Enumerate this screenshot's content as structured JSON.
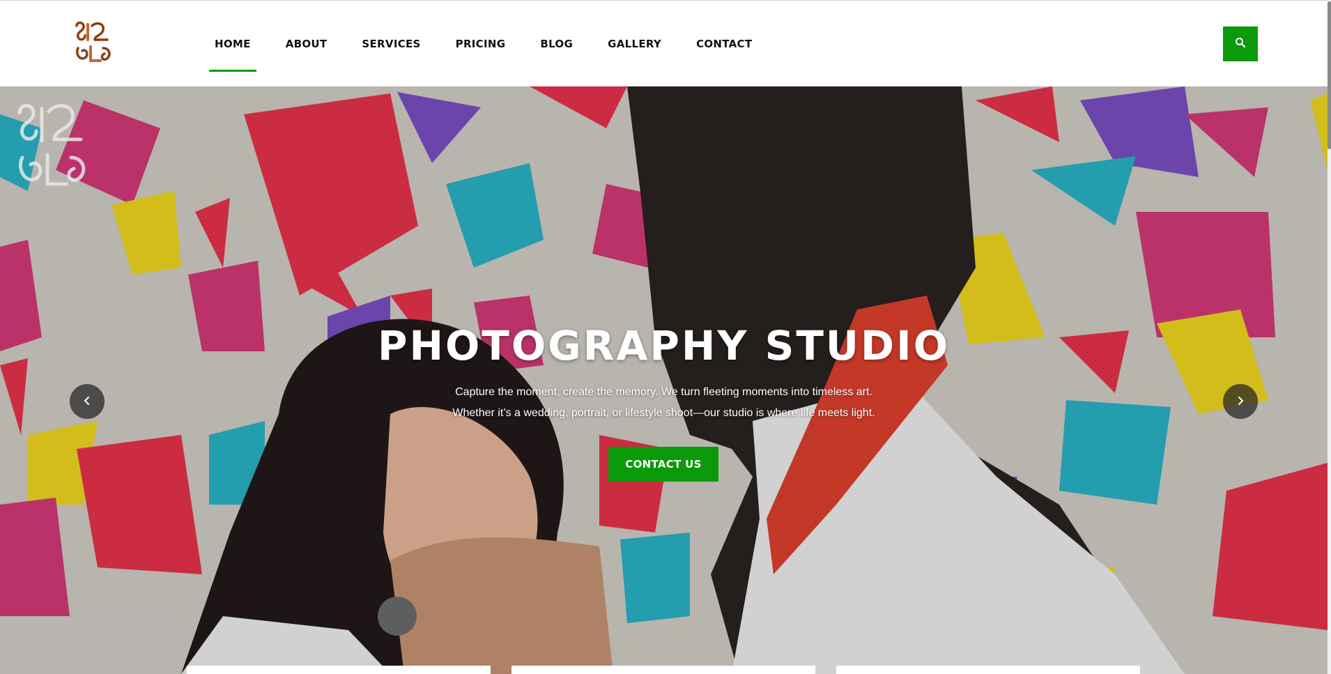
{
  "header": {
    "logo_icon": "brand-logo-icon",
    "nav": [
      {
        "label": "HOME",
        "active": true
      },
      {
        "label": "ABOUT",
        "active": false
      },
      {
        "label": "SERVICES",
        "active": false
      },
      {
        "label": "PRICING",
        "active": false
      },
      {
        "label": "BLOG",
        "active": false
      },
      {
        "label": "GALLERY",
        "active": false
      },
      {
        "label": "CONTACT",
        "active": false
      }
    ],
    "search_icon": "search-icon"
  },
  "hero": {
    "title": "PHOTOGRAPHY STUDIO",
    "text_line1": "Capture the moment, create the memory. We turn fleeting moments into timeless art.",
    "text_line2": "Whether it’s a wedding, portrait, or lifestyle shoot—our studio is where life meets light.",
    "cta_label": "CONTACT US",
    "prev_icon": "chevron-left-icon",
    "next_icon": "chevron-right-icon"
  },
  "colors": {
    "accent": "#0a9a0a",
    "nav_text": "#111111",
    "hero_text": "#ffffff",
    "arrow_bg": "#2c2c2c"
  }
}
